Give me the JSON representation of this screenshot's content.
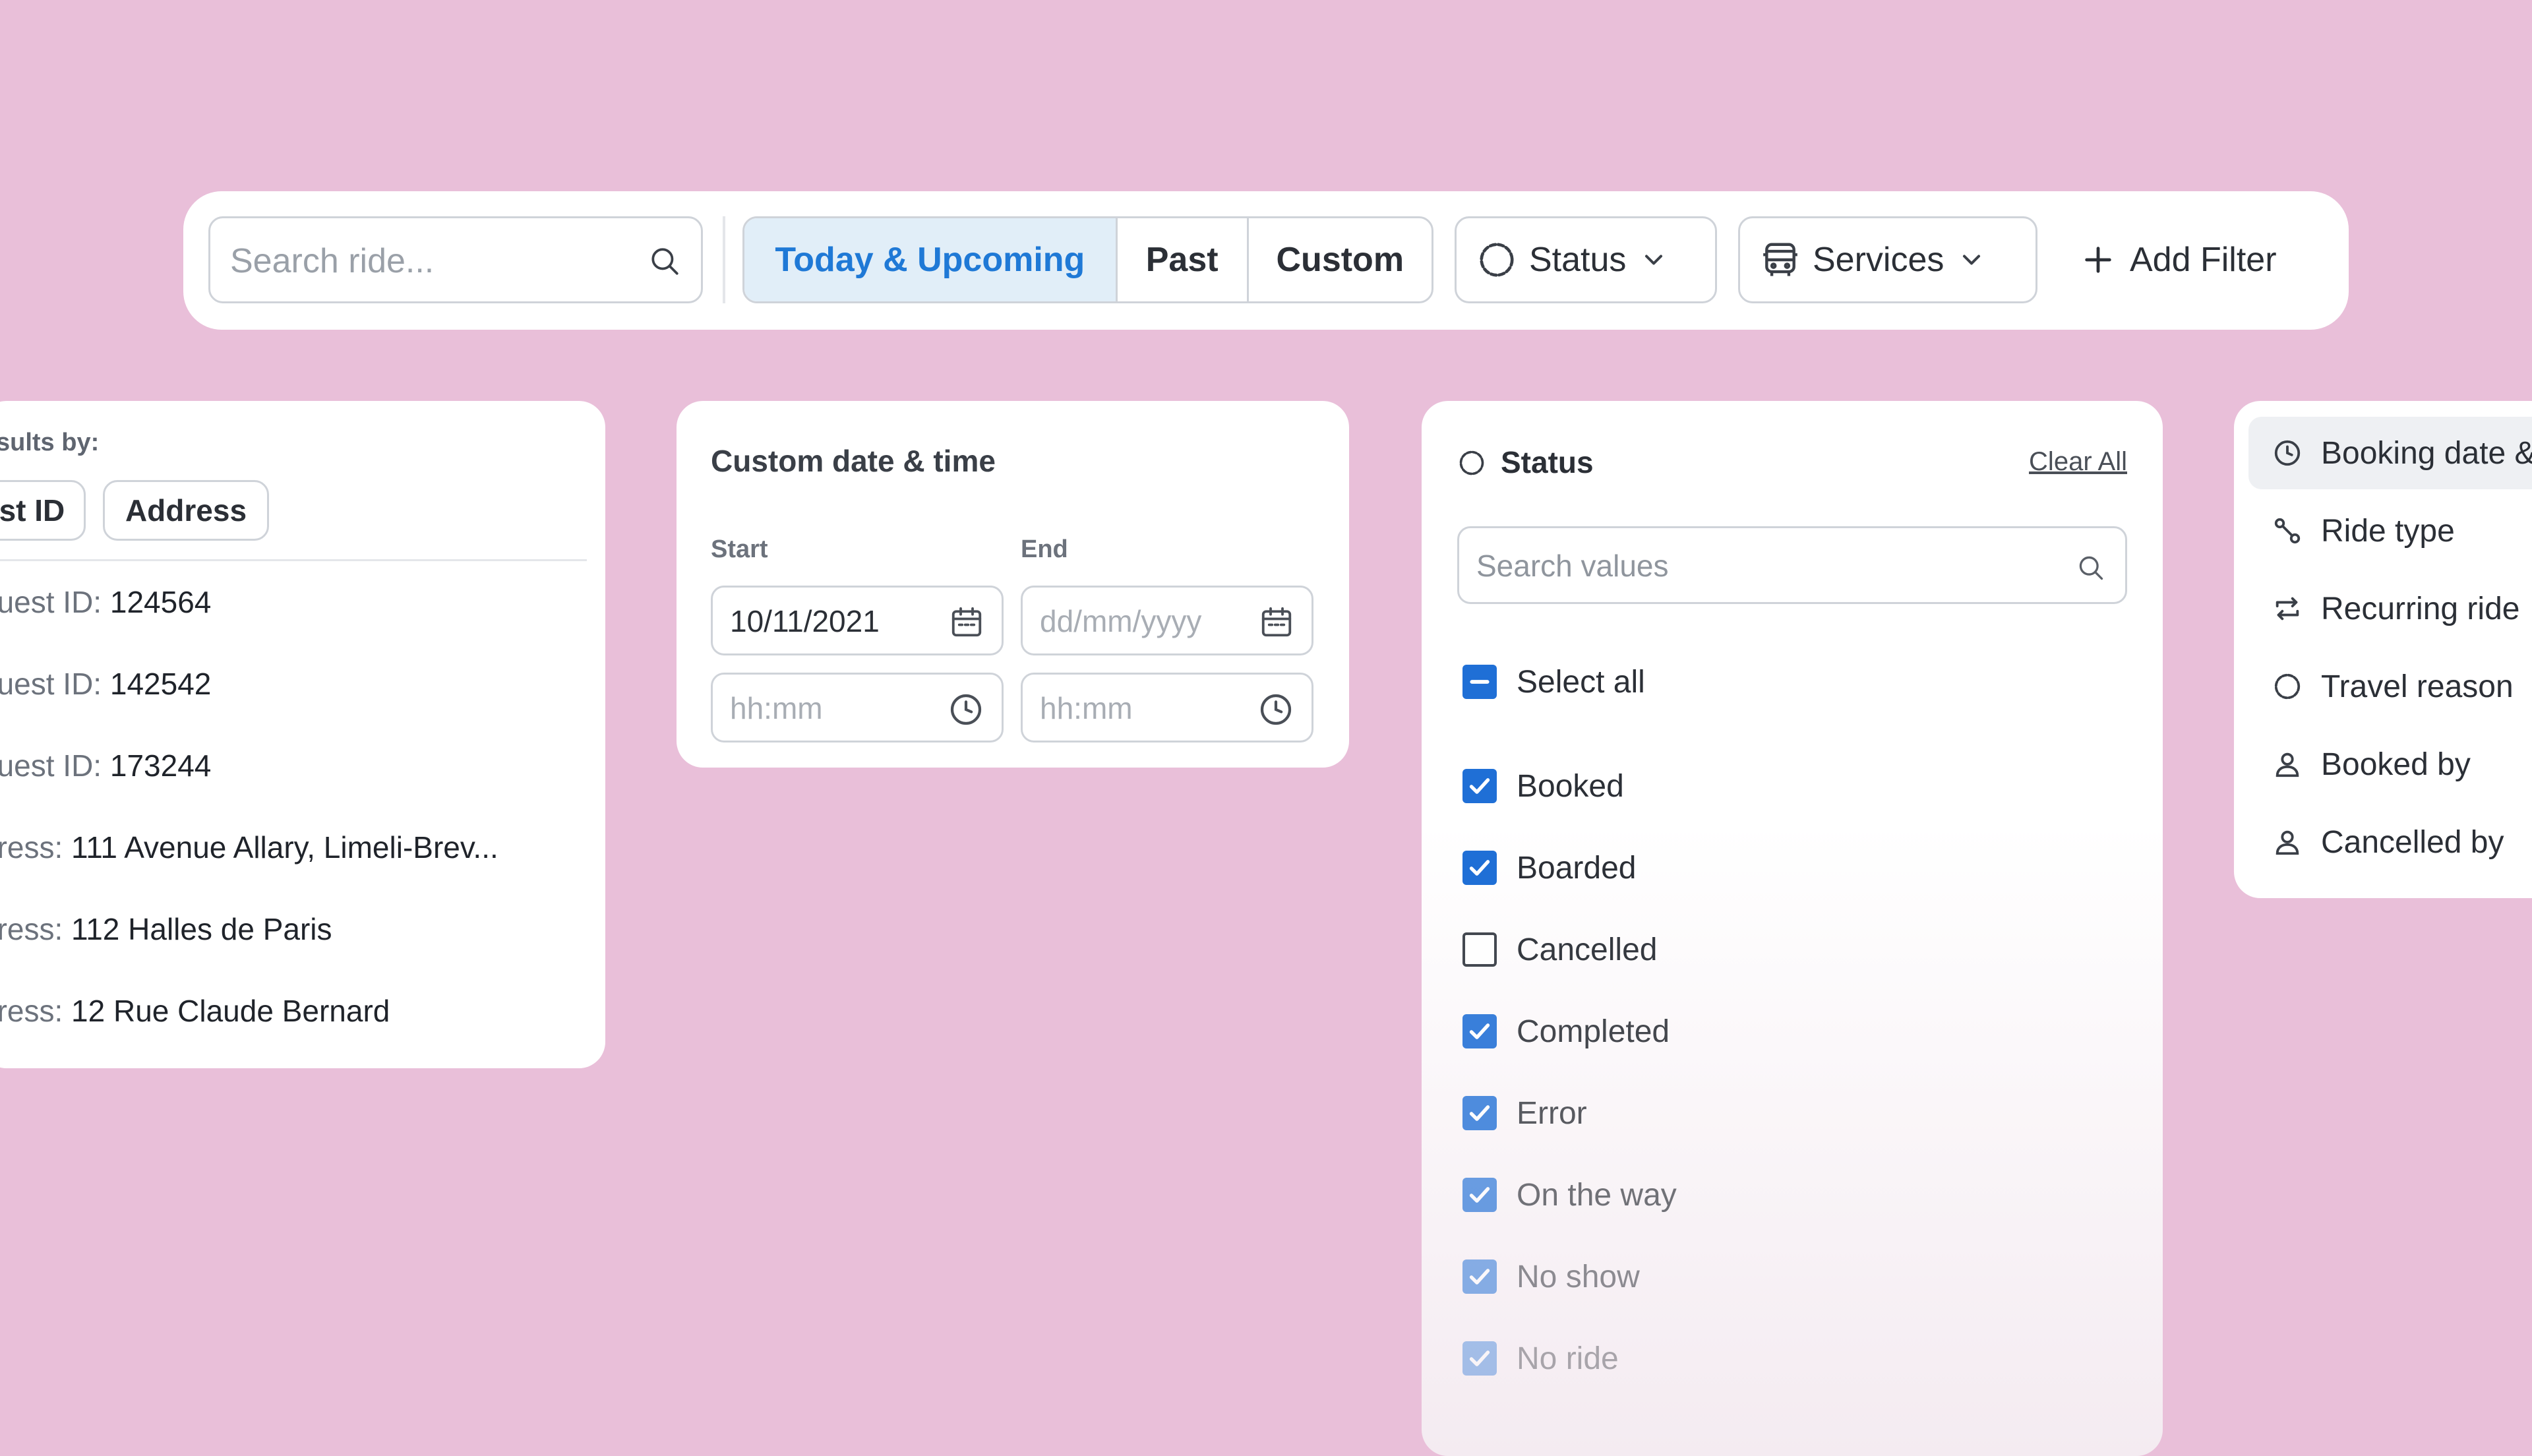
{
  "toolbar": {
    "search_placeholder": "Search ride...",
    "segments": [
      "Today & Upcoming",
      "Past",
      "Custom"
    ],
    "status_label": "Status",
    "services_label": "Services",
    "add_filter_label": "Add Filter",
    "accent_color": "#1f79d6"
  },
  "results_card": {
    "heading": "sults by:",
    "chips": [
      "est ID",
      "Address"
    ],
    "rows": [
      {
        "key": "quest ID: ",
        "value": "124564"
      },
      {
        "key": "quest ID: ",
        "value": "142542"
      },
      {
        "key": "quest ID: ",
        "value": "173244"
      },
      {
        "key": "dress: ",
        "value": "111 Avenue Allary, Limeli-Brev..."
      },
      {
        "key": "dress: ",
        "value": "112 Halles de Paris"
      },
      {
        "key": "dress: ",
        "value": "12 Rue Claude Bernard"
      }
    ]
  },
  "date_card": {
    "title": "Custom date & time",
    "start_label": "Start",
    "end_label": "End",
    "start_date": "10/11/2021",
    "date_placeholder": "dd/mm/yyyy",
    "time_placeholder": "hh:mm"
  },
  "status_card": {
    "title": "Status",
    "clear_all": "Clear All",
    "search_placeholder": "Search values",
    "select_all": "Select all",
    "items": [
      {
        "label": "Booked",
        "checked": true
      },
      {
        "label": "Boarded",
        "checked": true
      },
      {
        "label": "Cancelled",
        "checked": false
      },
      {
        "label": "Completed",
        "checked": true
      },
      {
        "label": "Error",
        "checked": true
      },
      {
        "label": "On the way",
        "checked": true
      },
      {
        "label": "No show",
        "checked": true
      },
      {
        "label": "No ride",
        "checked": true
      }
    ],
    "checkbox_color": "#1f6fd6"
  },
  "filter_menu": {
    "items": [
      {
        "label": "Booking date &",
        "icon": "clock-icon"
      },
      {
        "label": "Ride type",
        "icon": "route-icon"
      },
      {
        "label": "Recurring ride",
        "icon": "repeat-icon"
      },
      {
        "label": "Travel reason",
        "icon": "circle-icon"
      },
      {
        "label": "Booked by",
        "icon": "user-icon"
      },
      {
        "label": "Cancelled by",
        "icon": "user-icon"
      }
    ]
  }
}
